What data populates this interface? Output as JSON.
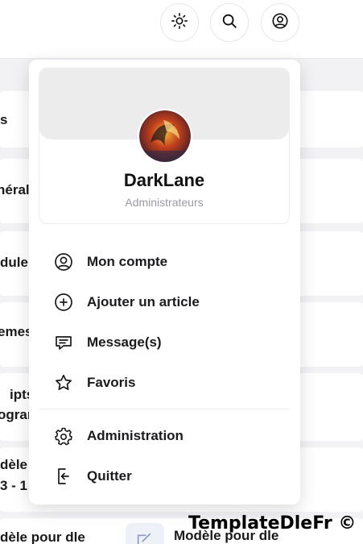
{
  "header": {
    "buttons": [
      {
        "name": "theme-toggle",
        "icon": "sun-icon"
      },
      {
        "name": "search",
        "icon": "search-icon"
      },
      {
        "name": "account",
        "icon": "user-circle-icon"
      }
    ]
  },
  "background": {
    "fragments": [
      "s",
      "néral",
      "dule",
      "emes",
      "ipts",
      "ogram",
      "dèle",
      "3 - 1",
      "dèle pour dle",
      "Modèle pour dle"
    ]
  },
  "profile": {
    "username": "DarkLane",
    "role": "Administrateurs"
  },
  "menu": {
    "items": [
      {
        "label": "Mon compte",
        "icon": "user-circle-icon"
      },
      {
        "label": "Ajouter un article",
        "icon": "plus-circle-icon"
      },
      {
        "label": "Message(s)",
        "icon": "message-icon"
      },
      {
        "label": "Favoris",
        "icon": "star-icon"
      },
      {
        "label": "Administration",
        "icon": "gear-icon"
      },
      {
        "label": "Quitter",
        "icon": "logout-icon"
      }
    ]
  },
  "watermark": "TemplateDleFr ©"
}
